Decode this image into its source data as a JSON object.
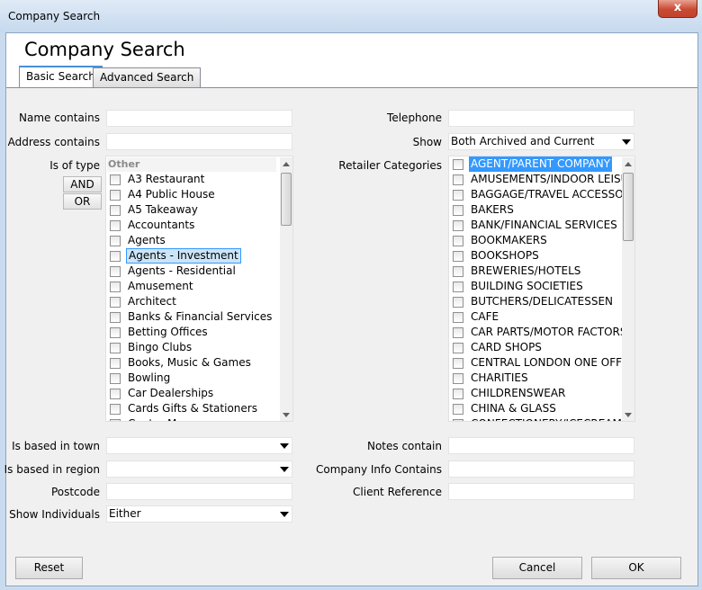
{
  "window": {
    "title": "Company Search",
    "close_glyph": "x"
  },
  "page": {
    "title": "Company Search"
  },
  "tabs": [
    {
      "label": "Basic Search",
      "active": true
    },
    {
      "label": "Advanced Search",
      "active": false
    }
  ],
  "form": {
    "name_contains": {
      "label": "Name contains",
      "value": ""
    },
    "address_contains": {
      "label": "Address contains",
      "value": ""
    },
    "telephone": {
      "label": "Telephone",
      "value": ""
    },
    "show": {
      "label": "Show",
      "value": "Both Archived and Current"
    },
    "is_of_type": {
      "label": "Is of type",
      "and_label": "AND",
      "or_label": "OR",
      "group_header": "Other",
      "items": [
        {
          "label": "A3 Restaurant",
          "checked": false
        },
        {
          "label": "A4 Public House",
          "checked": false
        },
        {
          "label": "A5 Takeaway",
          "checked": false
        },
        {
          "label": "Accountants",
          "checked": false
        },
        {
          "label": "Agents",
          "checked": false
        },
        {
          "label": "Agents - Investment",
          "checked": false,
          "selected": true
        },
        {
          "label": "Agents - Residential",
          "checked": false
        },
        {
          "label": "Amusement",
          "checked": false
        },
        {
          "label": "Architect",
          "checked": false
        },
        {
          "label": "Banks & Financial Services",
          "checked": false
        },
        {
          "label": "Betting Offices",
          "checked": false
        },
        {
          "label": "Bingo Clubs",
          "checked": false
        },
        {
          "label": "Books, Music & Games",
          "checked": false
        },
        {
          "label": "Bowling",
          "checked": false
        },
        {
          "label": "Car Dealerships",
          "checked": false
        },
        {
          "label": "Cards Gifts & Stationers",
          "checked": false
        },
        {
          "label": "Centre M...",
          "checked": false
        }
      ]
    },
    "retailer_categories": {
      "label": "Retailer Categories",
      "items": [
        {
          "label": "AGENT/PARENT COMPANY",
          "checked": false,
          "selected": true
        },
        {
          "label": "AMUSEMENTS/INDOOR LEISUR",
          "checked": false
        },
        {
          "label": "BAGGAGE/TRAVEL ACCESSORY",
          "checked": false
        },
        {
          "label": "BAKERS",
          "checked": false
        },
        {
          "label": "BANK/FINANCIAL SERVICES",
          "checked": false
        },
        {
          "label": "BOOKMAKERS",
          "checked": false
        },
        {
          "label": "BOOKSHOPS",
          "checked": false
        },
        {
          "label": "BREWERIES/HOTELS",
          "checked": false
        },
        {
          "label": "BUILDING SOCIETIES",
          "checked": false
        },
        {
          "label": "BUTCHERS/DELICATESSEN",
          "checked": false
        },
        {
          "label": "CAFE",
          "checked": false
        },
        {
          "label": "CAR PARTS/MOTOR FACTORS",
          "checked": false
        },
        {
          "label": "CARD SHOPS",
          "checked": false
        },
        {
          "label": "CENTRAL LONDON ONE OFFS",
          "checked": false
        },
        {
          "label": "CHARITIES",
          "checked": false
        },
        {
          "label": "CHILDRENSWEAR",
          "checked": false
        },
        {
          "label": "CHINA & GLASS",
          "checked": false
        },
        {
          "label": "CONFECTIONERY/ICECREAM",
          "checked": false
        }
      ]
    },
    "based_in_town": {
      "label": "Is based in town",
      "value": ""
    },
    "based_in_region": {
      "label": "Is based in region",
      "value": ""
    },
    "postcode": {
      "label": "Postcode",
      "value": ""
    },
    "show_individuals": {
      "label": "Show Individuals",
      "value": "Either"
    },
    "notes_contain": {
      "label": "Notes contain",
      "value": ""
    },
    "company_info_contains": {
      "label": "Company Info Contains",
      "value": ""
    },
    "client_reference": {
      "label": "Client Reference",
      "value": ""
    }
  },
  "footer": {
    "reset": "Reset",
    "cancel": "Cancel",
    "ok": "OK"
  },
  "icons": {
    "close": "close-icon",
    "dropdown": "chevron-down-icon",
    "checkbox": "checkbox-icon"
  },
  "colors": {
    "selection": "#3399ff",
    "accent_tab": "#4a8fd8"
  }
}
